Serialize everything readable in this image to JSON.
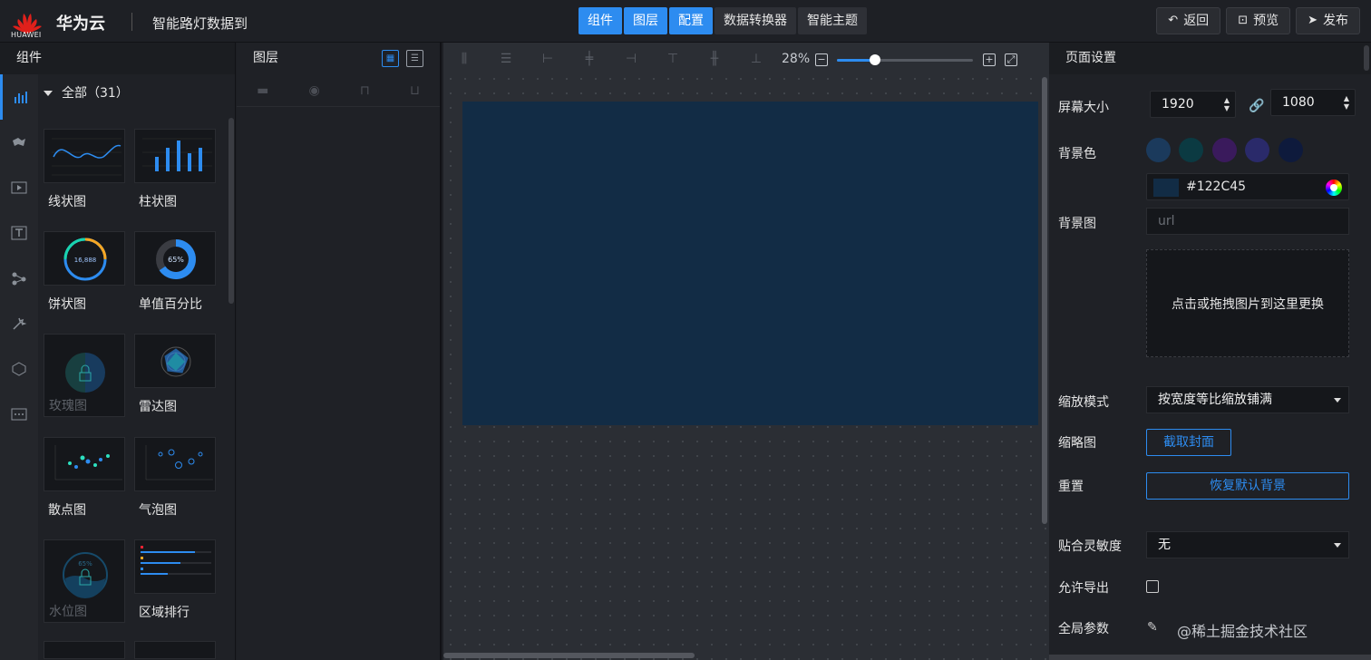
{
  "header": {
    "logo_text": "HUAWEI",
    "brand": "华为云",
    "project_title": "智能路灯数据到",
    "tabs": [
      {
        "label": "组件",
        "active": true
      },
      {
        "label": "图层",
        "active": true
      },
      {
        "label": "配置",
        "active": true
      },
      {
        "label": "数据转换器",
        "active": false
      },
      {
        "label": "智能主题",
        "active": false
      }
    ],
    "back_label": "返回",
    "preview_label": "预览",
    "publish_label": "发布"
  },
  "components": {
    "title": "组件",
    "category": "全部（31）",
    "items": [
      {
        "label": "线状图",
        "locked": false
      },
      {
        "label": "柱状图",
        "locked": false
      },
      {
        "label": "饼状图",
        "locked": false
      },
      {
        "label": "单值百分比",
        "locked": false
      },
      {
        "label": "玫瑰图",
        "locked": true
      },
      {
        "label": "雷达图",
        "locked": false
      },
      {
        "label": "散点图",
        "locked": false
      },
      {
        "label": "气泡图",
        "locked": false
      },
      {
        "label": "水位图",
        "locked": true
      },
      {
        "label": "区域排行",
        "locked": false
      }
    ],
    "thumb_texts": {
      "pie": "16,888",
      "percent": "65%",
      "water": "65%"
    }
  },
  "layers": {
    "title": "图层"
  },
  "canvas": {
    "zoom": "28%",
    "zoom_fraction": 0.28,
    "screen_color": "#122C45"
  },
  "settings": {
    "title": "页面设置",
    "screen_size_label": "屏幕大小",
    "width": "1920",
    "height": "1080",
    "bg_color_label": "背景色",
    "swatches": [
      "#1b3a5c",
      "#0b3a42",
      "#3a1a5c",
      "#2a2a6a",
      "#0e1a3c"
    ],
    "bg_color_value": "#122C45",
    "bg_image_label": "背景图",
    "url_placeholder": "url",
    "upload_text": "点击或拖拽图片到这里更换",
    "scale_mode_label": "缩放模式",
    "scale_mode_value": "按宽度等比缩放铺满",
    "thumbnail_label": "缩略图",
    "capture_cover": "截取封面",
    "reset_label": "重置",
    "restore_default_bg": "恢复默认背景",
    "snap_label": "贴合灵敏度",
    "snap_value": "无",
    "allow_export_label": "允许导出",
    "global_params_label": "全局参数",
    "watermark": "@稀土掘金技术社区"
  }
}
